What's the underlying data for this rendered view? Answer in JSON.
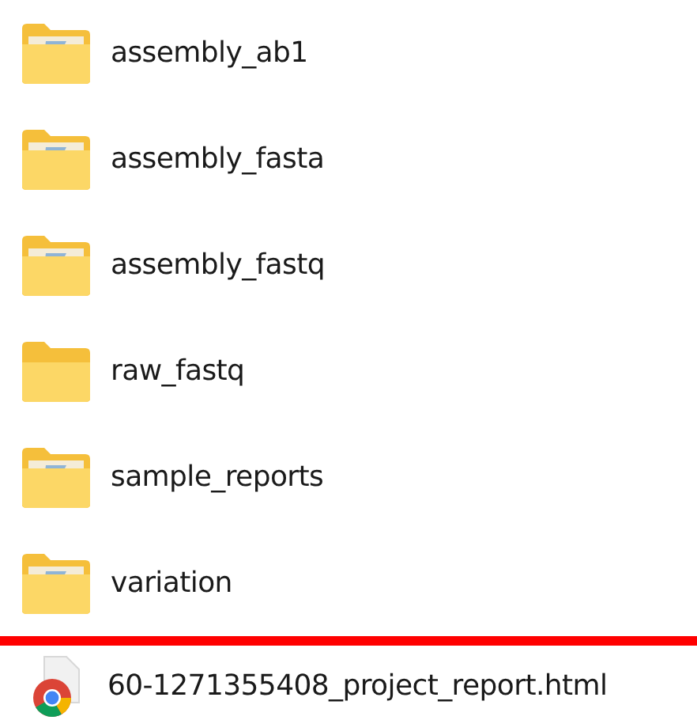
{
  "folders": [
    {
      "name": "assembly_ab1",
      "kind": "filled"
    },
    {
      "name": "assembly_fasta",
      "kind": "filled"
    },
    {
      "name": "assembly_fastq",
      "kind": "filled"
    },
    {
      "name": "raw_fastq",
      "kind": "empty"
    },
    {
      "name": "sample_reports",
      "kind": "filled"
    },
    {
      "name": "variation",
      "kind": "filled"
    }
  ],
  "files": [
    {
      "name": "60-1271355408_project_report.html",
      "kind": "browser-document"
    }
  ]
}
